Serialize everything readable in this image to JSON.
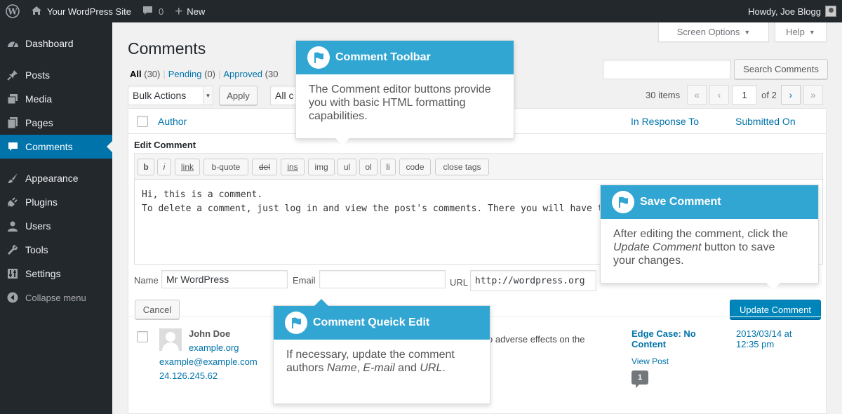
{
  "adminbar": {
    "site_name": "Your WordPress Site",
    "comments_count": "0",
    "new_label": "New",
    "howdy": "Howdy, Joe Blogg"
  },
  "sidebar": {
    "items": [
      {
        "label": "Dashboard",
        "icon": "dashboard-icon"
      },
      {
        "label": "Posts",
        "icon": "pin-icon"
      },
      {
        "label": "Media",
        "icon": "media-icon"
      },
      {
        "label": "Pages",
        "icon": "pages-icon"
      },
      {
        "label": "Comments",
        "icon": "comment-icon"
      },
      {
        "label": "Appearance",
        "icon": "brush-icon"
      },
      {
        "label": "Plugins",
        "icon": "plug-icon"
      },
      {
        "label": "Users",
        "icon": "user-icon"
      },
      {
        "label": "Tools",
        "icon": "wrench-icon"
      },
      {
        "label": "Settings",
        "icon": "settings-icon"
      }
    ],
    "collapse_label": "Collapse menu",
    "current": "Comments"
  },
  "screen_options": "Screen Options",
  "help": "Help",
  "page_title": "Comments",
  "filters": {
    "all": "All",
    "all_count": "(30)",
    "pending": "Pending",
    "pending_count": "(0)",
    "approved": "Approved",
    "approved_count": "(30"
  },
  "search": {
    "value": "",
    "button": "Search Comments"
  },
  "bulk": {
    "select": "Bulk Actions",
    "apply": "Apply",
    "filter_select": "All c"
  },
  "pagination": {
    "items": "30 items",
    "first": "«",
    "prev": "‹",
    "current_page": "1",
    "of": "of 2",
    "next": "›",
    "last": "»"
  },
  "table": {
    "col_author": "Author",
    "col_response": "In Response To",
    "col_submitted": "Submitted On"
  },
  "editor": {
    "label": "Edit Comment",
    "buttons": [
      "b",
      "i",
      "link",
      "b-quote",
      "del",
      "ins",
      "img",
      "ul",
      "ol",
      "li",
      "code",
      "close tags"
    ],
    "line1": "Hi, this is a comment.",
    "line2": "To delete a comment, just log in and view the post's comments. There you will have t"
  },
  "fields": {
    "name_label": "Name",
    "name_value": "Mr WordPress",
    "email_label": "Email",
    "email_value": "",
    "url_label": "URL",
    "url_value": "http://wordpress.org"
  },
  "actions": {
    "cancel": "Cancel",
    "update": "Update Comment"
  },
  "comment_row": {
    "author": "John Doe",
    "site": "example.org",
    "email": "example@example.com",
    "ip": "24.126.245.62",
    "excerpt": "o adverse effects on the",
    "response_title_1": "Edge Case: No",
    "response_title_2": "Content",
    "view_post": "View Post",
    "bubble_count": "1",
    "date": "2013/03/14 at",
    "time": "12:35 pm"
  },
  "pointers": {
    "toolbar": {
      "title": "Comment Toolbar",
      "body_1": "The Comment editor buttons provide",
      "body_2": "you with basic HTML formatting",
      "body_3": "capabilities."
    },
    "save": {
      "title": "Save Comment",
      "body_1": "After editing the comment, click the",
      "body_2_em": "Update Comment",
      "body_2_rest": " button to save",
      "body_3": "your changes."
    },
    "quickedit": {
      "title": "Comment Queick Edit",
      "body_1": "If necessary, update the comment",
      "body_2_pre": "authors ",
      "body_2_name": "Name",
      "body_2_sep": ", ",
      "body_2_email": "E-mail",
      "body_2_and": " and ",
      "body_2_url": "URL",
      "body_2_end": "."
    }
  },
  "colors": {
    "adminbar": "#23282d",
    "accent": "#0073aa",
    "pointer_head": "#32a6d3",
    "primary_button": "#0085ba"
  }
}
